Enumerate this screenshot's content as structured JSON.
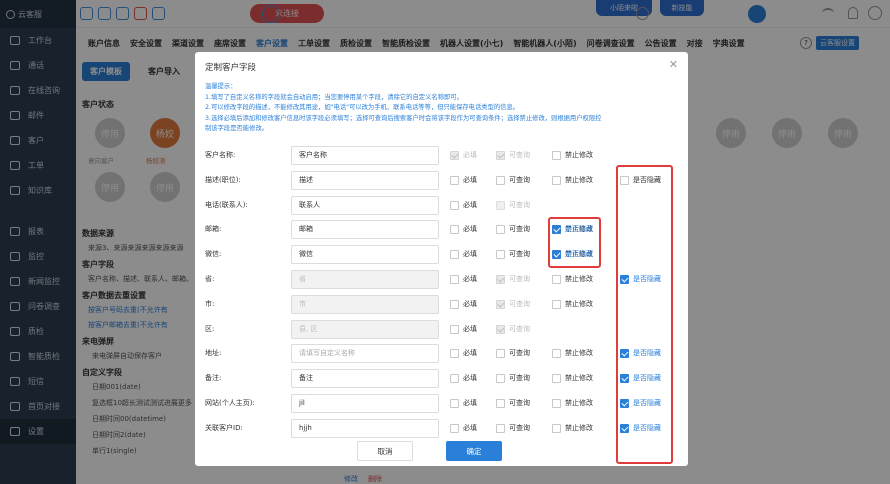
{
  "app": {
    "title": "云客服"
  },
  "topbar": {
    "connect_label": "未连接",
    "badge1": "小陌来啦",
    "badge2": "新技能"
  },
  "sidebar": {
    "items": [
      {
        "label": "工作台",
        "icon": "home-icon"
      },
      {
        "label": "通话",
        "icon": "phone-icon"
      },
      {
        "label": "在线咨询",
        "icon": "chat-icon"
      },
      {
        "label": "邮件",
        "icon": "mail-icon"
      },
      {
        "label": "客户",
        "icon": "user-icon"
      },
      {
        "label": "工单",
        "icon": "ticket-icon"
      },
      {
        "label": "知识库",
        "icon": "book-icon"
      },
      {
        "label": "报表",
        "icon": "report-icon"
      },
      {
        "label": "监控",
        "icon": "monitor-icon"
      },
      {
        "label": "新闻监控",
        "icon": "news-icon"
      },
      {
        "label": "问卷调查",
        "icon": "survey-icon"
      },
      {
        "label": "质检",
        "icon": "quality-icon"
      },
      {
        "label": "智能质检",
        "icon": "ai-quality-icon"
      },
      {
        "label": "短信",
        "icon": "sms-icon"
      },
      {
        "label": "首页对接",
        "icon": "link-icon"
      },
      {
        "label": "设置",
        "icon": "settings-icon"
      }
    ]
  },
  "nav": {
    "tabs": [
      "账户信息",
      "安全设置",
      "渠道设置",
      "座席设置",
      "客户设置",
      "工单设置",
      "质检设置",
      "智能质检设置",
      "机器人设置(小七)",
      "智能机器人(小陌)",
      "问卷调查设置",
      "公告设置",
      "对接",
      "字典设置"
    ],
    "active": 4,
    "help_label": "?",
    "help_link": "云客服设置"
  },
  "subtabs": {
    "items": [
      "客户模板",
      "客户导入"
    ]
  },
  "background": {
    "status_title": "客户状态",
    "status_circles": [
      "停用",
      "杨姣",
      "停用",
      "停用",
      "停用",
      "停用",
      "停用",
      "停用"
    ],
    "status_sub": [
      "意向客户",
      "杨姣测"
    ],
    "data_source_title": "数据来源",
    "data_source_row": "来源3、来源来源来源来源来源",
    "fields_title": "客户字段",
    "fields_row": "客户名称、描述、联系人、邮箱、",
    "dedup_title": "客户数据去重设置",
    "dedup_rows": [
      "按客户号码去重(不允许有",
      "按客户邮箱去重(不允许有"
    ],
    "popup_title": "来电弹屏",
    "popup_row": "来电弹屏自动保存客户",
    "custom_title": "自定义字段",
    "custom_rows": [
      "日期001(date)",
      "复选框10超长测试测试进展更多",
      "日期时间00(datetime)",
      "日期时间2(date)",
      "单行1(single)"
    ],
    "bottom_links": [
      "修改",
      "删除"
    ]
  },
  "modal": {
    "title": "定制客户字段",
    "notice": [
      "温馨提示：",
      "1.填写了自定义名称的字段就会自动启用；当您要停用某个字段，清除它的自定义名称即可。",
      "2.可以修改字段的描述，不能修改其用途，如\"电话\"可以改为手机、联系电话等等，但只能保存电话类型的信息。",
      "3.选择必填后添加和修改客户信息时该字段必须填写；选择可查询后搜索客户时会将该字段作为可查询条件；选择禁止修改，则根据用户权限控",
      "制该字段是否能修改。"
    ],
    "labels": {
      "required": "必填",
      "queryable": "可查询",
      "no_edit": "禁止修改",
      "hide": "是否隐藏"
    },
    "fields": [
      {
        "label": "客户名称:",
        "value": "客户名称",
        "placeholder": "",
        "input_disabled": false,
        "req": "dison",
        "query": "dison",
        "noedit": "off",
        "hide": null,
        "hide_boxed": false
      },
      {
        "label": "描述(职位):",
        "value": "描述",
        "placeholder": "",
        "input_disabled": false,
        "req": "off",
        "query": "off",
        "noedit": "off",
        "hide": "off",
        "hide_boxed": false
      },
      {
        "label": "电话(联系人):",
        "value": "联系人",
        "placeholder": "",
        "input_disabled": false,
        "req": "off",
        "query": "dis",
        "noedit": null,
        "hide": null,
        "hide_boxed": false
      },
      {
        "label": "邮箱:",
        "value": "邮箱",
        "placeholder": "",
        "input_disabled": false,
        "req": "off",
        "query": "off",
        "noedit": "off",
        "hide": "on",
        "hide_boxed": true
      },
      {
        "label": "微信:",
        "value": "微信",
        "placeholder": "",
        "input_disabled": false,
        "req": "off",
        "query": "off",
        "noedit": "off",
        "hide": "on",
        "hide_boxed": true
      },
      {
        "label": "省:",
        "value": "",
        "placeholder": "省",
        "input_disabled": true,
        "req": "off",
        "query": "dison",
        "noedit": "off",
        "hide": "on",
        "hide_boxed": false
      },
      {
        "label": "市:",
        "value": "",
        "placeholder": "市",
        "input_disabled": true,
        "req": "off",
        "query": "dison",
        "noedit": "off",
        "hide": null,
        "hide_boxed": false
      },
      {
        "label": "区:",
        "value": "",
        "placeholder": "县, 区",
        "input_disabled": true,
        "req": "off",
        "query": "dison",
        "noedit": null,
        "hide": null,
        "hide_boxed": false
      },
      {
        "label": "地址:",
        "value": "",
        "placeholder": "请填写自定义名称",
        "input_disabled": false,
        "req": "off",
        "query": "off",
        "noedit": "off",
        "hide": "on",
        "hide_boxed": false
      },
      {
        "label": "备注:",
        "value": "备注",
        "placeholder": "",
        "input_disabled": false,
        "req": "off",
        "query": "off",
        "noedit": "off",
        "hide": "on",
        "hide_boxed": false
      },
      {
        "label": "网站(个人主页):",
        "value": "jil",
        "placeholder": "",
        "input_disabled": false,
        "req": "off",
        "query": "off",
        "noedit": "off",
        "hide": "on",
        "hide_boxed": false
      },
      {
        "label": "关联客户ID:",
        "value": "hjjh",
        "placeholder": "",
        "input_disabled": false,
        "req": "off",
        "query": "off",
        "noedit": "off",
        "hide": "on",
        "hide_boxed": false
      }
    ],
    "cancel_label": "取消",
    "ok_label": "确定"
  }
}
